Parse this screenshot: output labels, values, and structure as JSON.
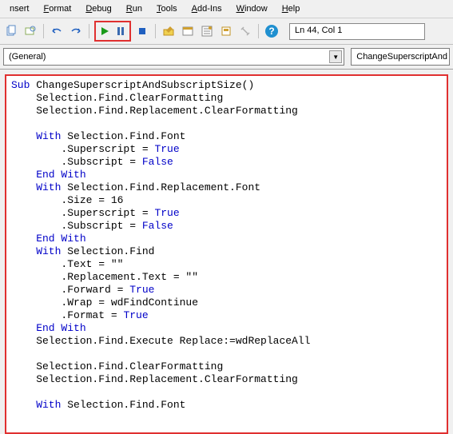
{
  "menu": {
    "insert": "nsert",
    "format": "Format",
    "debug": "Debug",
    "run": "Run",
    "tools": "Tools",
    "addins": "Add-Ins",
    "window": "Window",
    "help": "Help"
  },
  "status": {
    "cursor": "Ln 44, Col 1"
  },
  "dropdown": {
    "general": "(General)",
    "proc": "ChangeSuperscriptAnd"
  },
  "code": {
    "sub1": "Sub",
    "sub2": " ChangeSuperscriptAndSubscriptSize()",
    "l2": "    Selection.Find.ClearFormatting",
    "l3": "    Selection.Find.Replacement.ClearFormatting",
    "blank": "",
    "w1a": "    With",
    "w1b": " Selection.Find.Font",
    "l6a": "        .Superscript = ",
    "tru": "True",
    "l7a": "        .Subscript = ",
    "fal": "False",
    "ew": "    End With",
    "w2a": "    With",
    "w2b": " Selection.Find.Replacement.Font",
    "l10": "        .Size = 16",
    "l11a": "        .Superscript = ",
    "l12a": "        .Subscript = ",
    "w3a": "    With",
    "w3b": " Selection.Find",
    "l15": "        .Text = \"\"",
    "l16": "        .Replacement.Text = \"\"",
    "l17a": "        .Forward = ",
    "l18": "        .Wrap = wdFindContinue",
    "l19a": "        .Format = ",
    "l21": "    Selection.Find.Execute Replace:=wdReplaceAll",
    "l23": "    Selection.Find.ClearFormatting",
    "l24": "    Selection.Find.Replacement.ClearFormatting",
    "w4a": "    With",
    "w4b": " Selection.Find.Font"
  }
}
